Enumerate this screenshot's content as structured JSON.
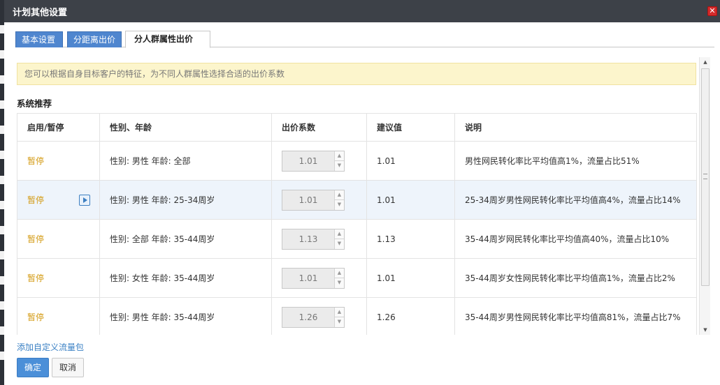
{
  "dialog": {
    "title": "计划其他设置",
    "close_glyph": "✕"
  },
  "tabs": [
    {
      "label": "基本设置",
      "active": false
    },
    {
      "label": "分距离出价",
      "active": false
    },
    {
      "label": "分人群属性出价",
      "active": true
    }
  ],
  "notice": "您可以根据自身目标客户的特征，为不同人群属性选择合适的出价系数",
  "section_title": "系统推荐",
  "table": {
    "headers": [
      "启用/暂停",
      "性别、年龄",
      "出价系数",
      "建议值",
      "说明"
    ],
    "rows": [
      {
        "action": "暂停",
        "attr": "性别: 男性 年龄: 全部",
        "coef": "1.01",
        "suggest": "1.01",
        "desc": "男性网民转化率比平均值高1%，流量占比51%",
        "highlight": false
      },
      {
        "action": "暂停",
        "attr": "性别: 男性 年龄: 25-34周岁",
        "coef": "1.01",
        "suggest": "1.01",
        "desc": "25-34周岁男性网民转化率比平均值高4%，流量占比14%",
        "highlight": true
      },
      {
        "action": "暂停",
        "attr": "性别: 全部 年龄: 35-44周岁",
        "coef": "1.13",
        "suggest": "1.13",
        "desc": "35-44周岁网民转化率比平均值高40%，流量占比10%",
        "highlight": false
      },
      {
        "action": "暂停",
        "attr": "性别: 女性 年龄: 35-44周岁",
        "coef": "1.01",
        "suggest": "1.01",
        "desc": "35-44周岁女性网民转化率比平均值高1%，流量占比2%",
        "highlight": false
      },
      {
        "action": "暂停",
        "attr": "性别: 男性 年龄: 35-44周岁",
        "coef": "1.26",
        "suggest": "1.26",
        "desc": "35-44周岁男性网民转化率比平均值高81%，流量占比7%",
        "highlight": false
      }
    ]
  },
  "footer": {
    "add_link": "添加自定义流量包",
    "ok_label": "确定",
    "cancel_label": "取消"
  },
  "colors": {
    "titlebar": "#3d4148",
    "tab_blue": "#4f86cf",
    "notice_bg": "#fcf5cc",
    "pause_link": "#d39a12",
    "link_blue": "#3a80c4",
    "ok_button": "#4b8fd8",
    "row_highlight": "#eef4fb"
  }
}
